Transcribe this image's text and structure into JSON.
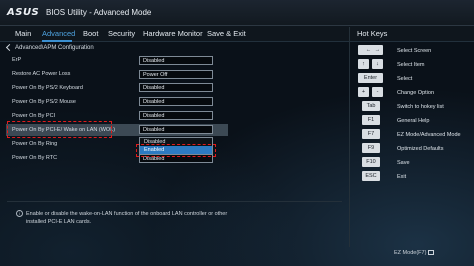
{
  "titlebar": {
    "logo": "ASUS",
    "title": "BIOS Utility - Advanced Mode"
  },
  "menu": [
    "Main",
    "Advanced",
    "Boot",
    "Security",
    "Hardware Monitor",
    "Save & Exit"
  ],
  "hot_keys_title": "Hot Keys",
  "breadcrumb": "Advanced\\APM Configuration",
  "settings": [
    {
      "label": "ErP",
      "value": "Disabled"
    },
    {
      "label": "Restore AC Power Loss",
      "value": "Power Off"
    },
    {
      "label": "Power On By PS/2 Keyboard",
      "value": "Disabled"
    },
    {
      "label": "Power On By PS/2 Mouse",
      "value": "Disabled"
    },
    {
      "label": "Power On By PCI",
      "value": "Disabled"
    },
    {
      "label": "Power On By PCI-E/ Wake on LAN (WOL)",
      "value": "Disabled"
    },
    {
      "label": "Power On By Ring",
      "value": "Disabled"
    },
    {
      "label": "Power On By RTC",
      "value": "Disabled"
    }
  ],
  "dropdown": {
    "options": [
      "Disabled",
      "Enabled"
    ],
    "selected": "Enabled"
  },
  "hotkeys": [
    {
      "keys": [
        "←",
        "→"
      ],
      "label": "Select Screen"
    },
    {
      "keys": [
        "↑",
        "↓"
      ],
      "label": "Select Item"
    },
    {
      "keys": [
        "Enter"
      ],
      "label": "Select"
    },
    {
      "keys": [
        "+",
        "-"
      ],
      "label": "Change Option"
    },
    {
      "keys": [
        "Tab"
      ],
      "label": "Switch to hokey list"
    },
    {
      "keys": [
        "F1"
      ],
      "label": "General Help"
    },
    {
      "keys": [
        "F7"
      ],
      "label": "EZ Mode/Advanced Mode"
    },
    {
      "keys": [
        "F9"
      ],
      "label": "Optimized Defaults"
    },
    {
      "keys": [
        "F10"
      ],
      "label": "Save"
    },
    {
      "keys": [
        "ESC"
      ],
      "label": "Exit"
    }
  ],
  "help_text": "Enable or disable the wake-on-LAN function of the onboard LAN controller or other installed PCI-E LAN cards.",
  "footer_mode": "EZ Mode(F7)",
  "colors": {
    "accent": "#3b8fd0",
    "highlight_outline": "#e21b1b",
    "selected_option": "#2c7bc2"
  }
}
